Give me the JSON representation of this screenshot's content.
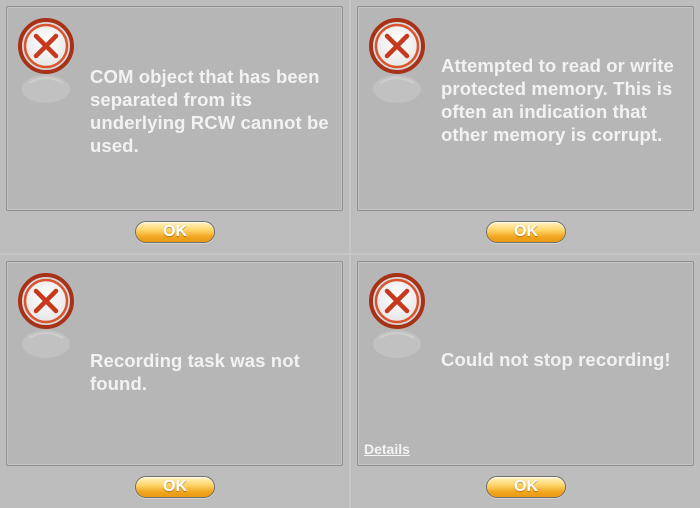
{
  "dialogs": [
    {
      "icon": "error-x-icon",
      "message": "COM object that has been separated from its underlying RCW cannot be used.",
      "ok_label": "OK"
    },
    {
      "icon": "error-x-icon",
      "message": "Attempted to read or write protected memory. This is often an indication that other memory is corrupt.",
      "ok_label": "OK"
    },
    {
      "icon": "error-x-icon",
      "message": "Recording task was not found.",
      "ok_label": "OK"
    },
    {
      "icon": "error-x-icon",
      "message": "Could not stop recording!",
      "details_label": "Details",
      "ok_label": "OK"
    }
  ],
  "colors": {
    "background": "#bdbdbd",
    "panel": "#b6b6b6",
    "text": "#f2f2f2",
    "error_red": "#c8381c",
    "button_gold": "#f1a51f"
  }
}
